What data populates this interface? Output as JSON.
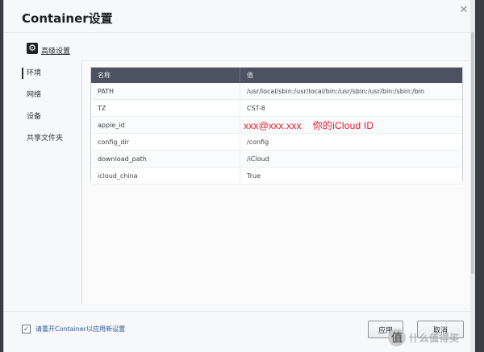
{
  "dialog": {
    "title": "Container设置",
    "advanced_settings": "高级设置",
    "nav": [
      "环境",
      "网络",
      "设备",
      "共享文件夹"
    ],
    "table": {
      "headers": [
        "名称",
        "值"
      ],
      "rows": [
        {
          "name": "PATH",
          "value": "/usr/local/sbin:/usr/local/bin:/usr/sbin:/usr/bin:/sbin:/bin"
        },
        {
          "name": "TZ",
          "value": "CST-8"
        },
        {
          "name": "apple_id",
          "value": ""
        },
        {
          "name": "config_dir",
          "value": "/config"
        },
        {
          "name": "download_path",
          "value": "/iCloud"
        },
        {
          "name": "icloud_china",
          "value": "True"
        }
      ]
    },
    "annotation": {
      "email": "xxx@xxx.xxx",
      "note": "你的iCloud ID"
    },
    "restart_checkbox": {
      "label": "请重开Container以应用新设置",
      "checked": true
    },
    "buttons": {
      "apply": "应用",
      "cancel": "取消"
    }
  },
  "watermark": {
    "text": "什么值得买"
  },
  "icons": {
    "close": "close-icon",
    "gear": "gear-icon",
    "check": "check-icon"
  }
}
